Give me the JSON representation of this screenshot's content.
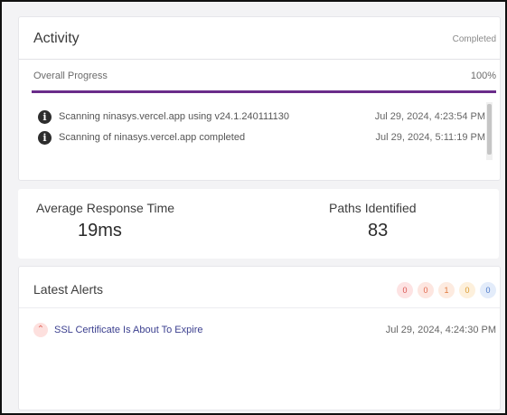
{
  "activity": {
    "title": "Activity",
    "status": "Completed",
    "progress": {
      "label": "Overall Progress",
      "value_text": "100%",
      "value": 100
    },
    "log": [
      {
        "icon": "info-icon",
        "message": "Scanning ninasys.vercel.app using v24.1.240111130",
        "time": "Jul 29, 2024, 4:23:54 PM"
      },
      {
        "icon": "info-icon",
        "message": "Scanning of ninasys.vercel.app completed",
        "time": "Jul 29, 2024, 5:11:19 PM"
      }
    ]
  },
  "stats": {
    "avg_response": {
      "label": "Average Response Time",
      "value": "19ms"
    },
    "paths": {
      "label": "Paths Identified",
      "value": "83"
    }
  },
  "alerts": {
    "title": "Latest Alerts",
    "severity_counts": [
      {
        "count": "0",
        "bg": "#fde3e3",
        "fg": "#d9534f"
      },
      {
        "count": "0",
        "bg": "#fde6e0",
        "fg": "#e0684e"
      },
      {
        "count": "1",
        "bg": "#fdebe0",
        "fg": "#e07a3e"
      },
      {
        "count": "0",
        "bg": "#fdf0dc",
        "fg": "#d99a2e"
      },
      {
        "count": "0",
        "bg": "#e3ecfa",
        "fg": "#4a78c8"
      }
    ],
    "items": [
      {
        "icon": "chevron-up-icon",
        "title": "SSL Certificate Is About To Expire",
        "time": "Jul 29, 2024, 4:24:30 PM"
      }
    ]
  },
  "colors": {
    "accent": "#6a2c8a",
    "link": "#3b3f8f"
  }
}
